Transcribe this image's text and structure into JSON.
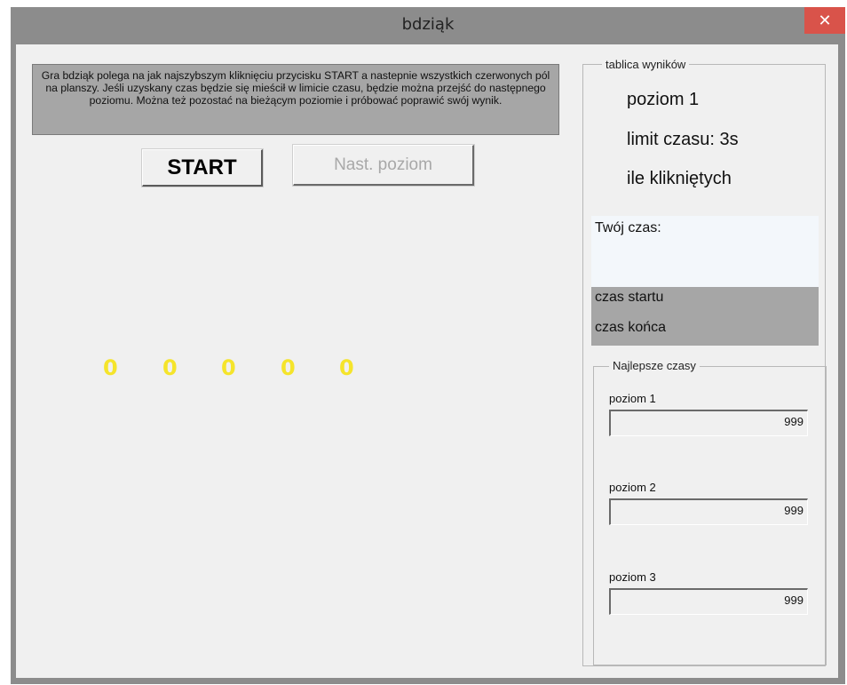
{
  "window": {
    "title": "bdziąk",
    "close_glyph": "✕"
  },
  "description": "Gra bdziąk polega na jak najszybszym kliknięciu przycisku START a nastepnie wszystkich czerwonych pól na planszy. Jeśli uzyskany czas będzie się mieścił w limicie czasu, będzie można przejść do następnego poziomu. Można też pozostać na bieżącym poziomie i próbować poprawić swój wynik.",
  "buttons": {
    "start_label": "START",
    "next_level_label": "Nast. poziom"
  },
  "counters": [
    "0",
    "0",
    "0",
    "0",
    "0"
  ],
  "scoreboard": {
    "legend": "tablica wyników",
    "level": "poziom 1",
    "time_limit": "limit czasu: 3s",
    "clicked": "ile klikniętych",
    "your_time_label": "Twój czas:",
    "start_time_label": "czas startu",
    "end_time_label": "czas końca"
  },
  "best_times": {
    "legend": "Najlepsze czasy",
    "levels": [
      {
        "label": "poziom 1",
        "value": "999"
      },
      {
        "label": "poziom 2",
        "value": "999"
      },
      {
        "label": "poziom 3",
        "value": "999"
      }
    ]
  },
  "colors": {
    "counter": "#f5e42b",
    "close_button": "#d9534a",
    "frame": "#8c8c8c"
  }
}
